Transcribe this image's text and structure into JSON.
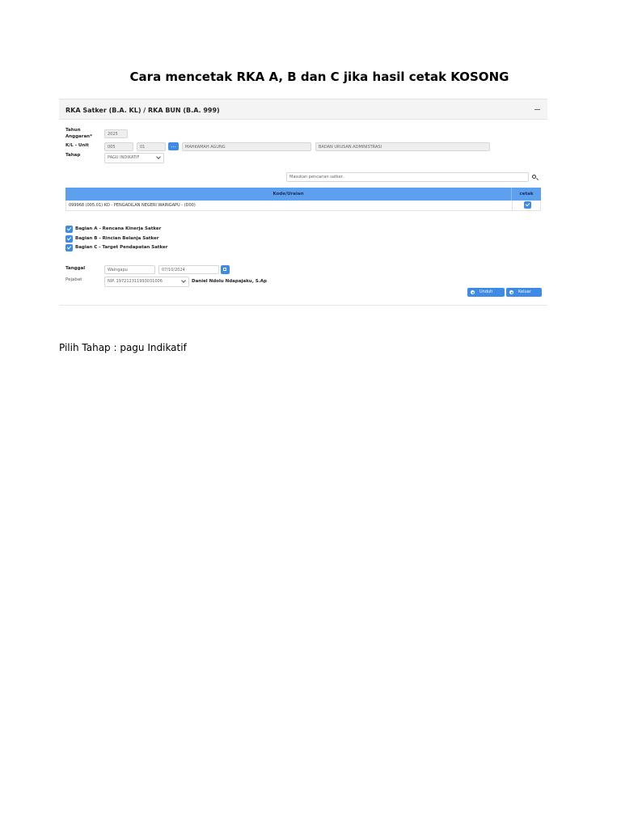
{
  "document": {
    "title": "Cara mencetak RKA A, B dan C jika hasil cetak KOSONG",
    "note": "Pilih Tahap : pagu Indikatif"
  },
  "panel": {
    "title": "RKA Satker (B.A. KL) / RKA BUN (B.A. 999)",
    "collapse_icon": "minus-icon"
  },
  "form": {
    "tahun_label_1": "Tahun",
    "tahun_label_2": "Anggaran*",
    "tahun_value": "2025",
    "kl_label": "K/L - Unit",
    "kl_code": "005",
    "unit_code": "01",
    "lookup_label": "...",
    "kl_name": "MAHKAMAH AGUNG",
    "unit_name": "BADAN URUSAN ADMINISTRASI",
    "tahap_label": "Tahap",
    "tahap_value": "PAGU INDIKATIF"
  },
  "search": {
    "placeholder": "Masukan pencarian satker..",
    "icon": "search-icon"
  },
  "table": {
    "columns": [
      "Kode/Uraian",
      "cetak"
    ],
    "rows": [
      {
        "uraian": "099968 (005.01) KD - PENGADILAN NEGERI WAINGAPU - (D00)",
        "cetak": true
      }
    ]
  },
  "bagian": [
    {
      "label": "Bagian A - Rencana Kinerja Satker",
      "checked": true
    },
    {
      "label": "Bagian B - Rincian Belanja Satker",
      "checked": true
    },
    {
      "label": "Bagian C - Target Pendapatan Satker",
      "checked": true
    }
  ],
  "signature": {
    "tanggal_label": "Tanggal",
    "place": "Waingapu",
    "date": "07/10/2024",
    "pejabat_label": "Pejabat",
    "nip": "NIP. 197212311993031006",
    "pejabat_name": "Daniel Ndolu Ndapajaku, S.Ap"
  },
  "actions": {
    "unduh": "Unduh",
    "keluar": "Keluar"
  },
  "colors": {
    "accent": "#3d8be6",
    "table_header": "#5da0ef"
  }
}
